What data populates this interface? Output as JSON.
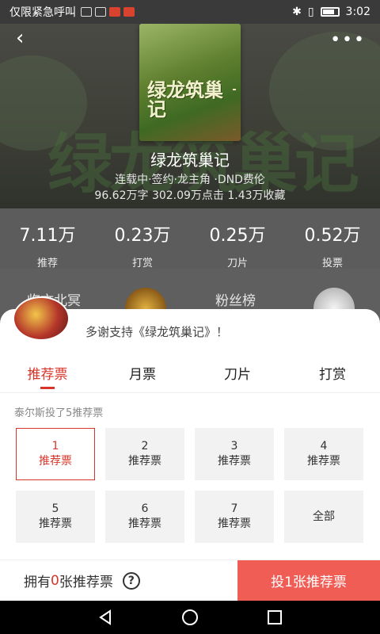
{
  "status_bar": {
    "left_text": "仅限紧急呼叫",
    "time": "3:02"
  },
  "header": {
    "back_icon": "‹",
    "more_icon": "•••"
  },
  "book": {
    "cover_title": "绿龙筑巢记",
    "title": "绿龙筑巢记",
    "meta": "连载中·签约·龙主角 ·DND费伦",
    "stats": "96.62万字 302.09万点击 1.43万收藏"
  },
  "stats": [
    {
      "value": "7.11万",
      "label": "推荐"
    },
    {
      "value": "0.23万",
      "label": "打赏"
    },
    {
      "value": "0.25万",
      "label": "刀片"
    },
    {
      "value": "0.52万",
      "label": "投票"
    }
  ],
  "fans": {
    "name": "临文北冥",
    "rank_label": "粉丝榜"
  },
  "sheet": {
    "thanks": "多谢支持《绿龙筑巢记》！",
    "tabs": [
      "推荐票",
      "月票",
      "刀片",
      "打赏"
    ],
    "active_tab": 0,
    "vote_note": "泰尔斯投了5推荐票",
    "options": [
      {
        "num": "1",
        "label": "推荐票"
      },
      {
        "num": "2",
        "label": "推荐票"
      },
      {
        "num": "3",
        "label": "推荐票"
      },
      {
        "num": "4",
        "label": "推荐票"
      },
      {
        "num": "5",
        "label": "推荐票"
      },
      {
        "num": "6",
        "label": "推荐票"
      },
      {
        "num": "7",
        "label": "推荐票"
      },
      {
        "num": "",
        "label": "全部"
      }
    ],
    "selected_option": 0
  },
  "bottom_bar": {
    "owned_prefix": "拥有",
    "owned_count": "0",
    "owned_suffix": "张推荐票",
    "help_icon": "?",
    "vote_button": "投1张推荐票"
  },
  "colors": {
    "accent": "#d8352a",
    "vote_button": "#ef5d55"
  }
}
